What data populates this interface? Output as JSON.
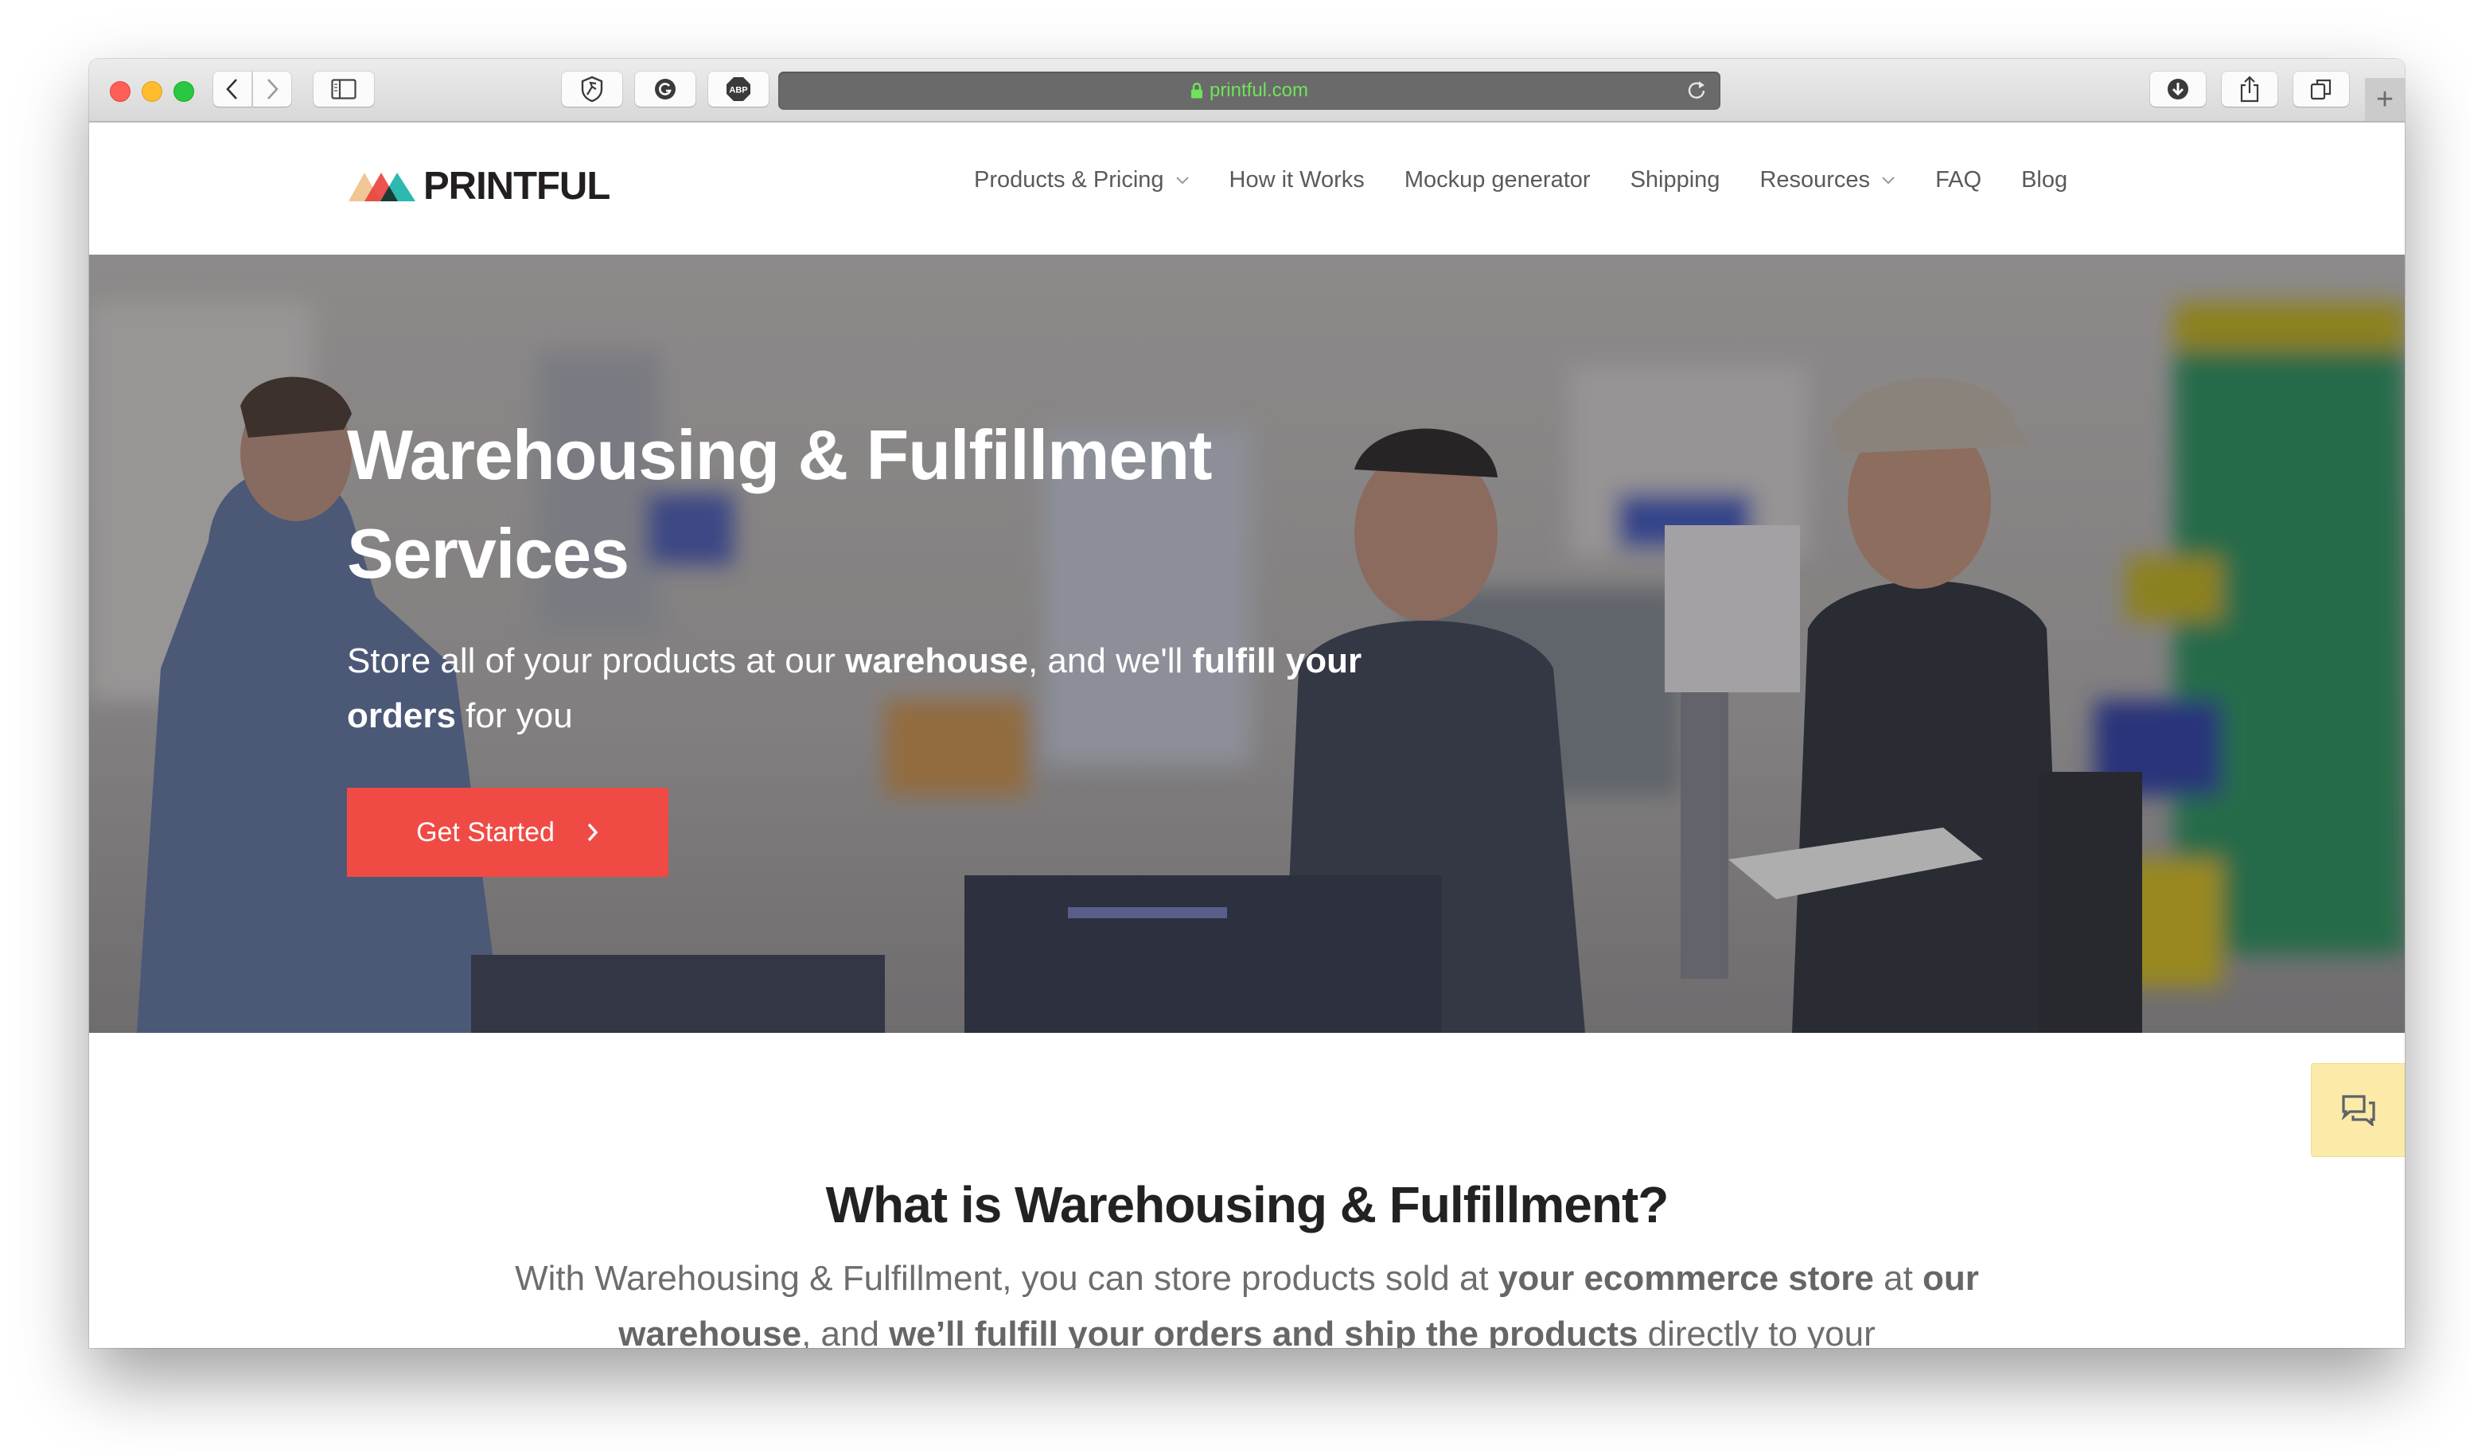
{
  "browser": {
    "url": "printful.com",
    "toolbar_icons": {
      "back": "chevron-left-icon",
      "forward": "chevron-right-icon",
      "sidebar": "sidebar-icon",
      "ext1": "shield-extension-icon",
      "ext2": "grammarly-icon",
      "ext3": "adblock-plus-icon",
      "ext3_label": "ABP",
      "reload": "reload-icon",
      "download": "download-icon",
      "share": "share-icon",
      "tabs": "tabs-overview-icon",
      "new_tab": "+"
    },
    "colors": {
      "url_text": "#6fe35b",
      "url_bg": "#6a6a6a"
    }
  },
  "header": {
    "logo_text": "PRINTFUL",
    "nav": [
      {
        "label": "Products & Pricing",
        "dropdown": true
      },
      {
        "label": "How it Works",
        "dropdown": false
      },
      {
        "label": "Mockup generator",
        "dropdown": false
      },
      {
        "label": "Shipping",
        "dropdown": false
      },
      {
        "label": "Resources",
        "dropdown": true
      },
      {
        "label": "FAQ",
        "dropdown": false
      },
      {
        "label": "Blog",
        "dropdown": false
      }
    ]
  },
  "hero": {
    "title_line1": "Warehousing & Fulfillment",
    "title_line2": "Services",
    "subtitle": {
      "p1": "Store all of your products at our ",
      "b1": "warehouse",
      "p2": ", and we'll ",
      "b2": "fulfill your orders",
      "p3": " for you"
    },
    "cta_label": "Get Started",
    "cta_color": "#f04a45"
  },
  "section": {
    "title": "What is Warehousing & Fulfillment?",
    "text": {
      "p1": "With Warehousing & Fulfillment, you can store products sold at ",
      "b1": "your ecommerce store",
      "p2": " at ",
      "b2": "our warehouse",
      "p3": ", and ",
      "b3": "we’ll fulfill your orders and ship the products",
      "p4": " directly to your"
    }
  },
  "chat_widget": {
    "icon": "chat-bubbles-icon",
    "bg": "#fbeaa8"
  }
}
